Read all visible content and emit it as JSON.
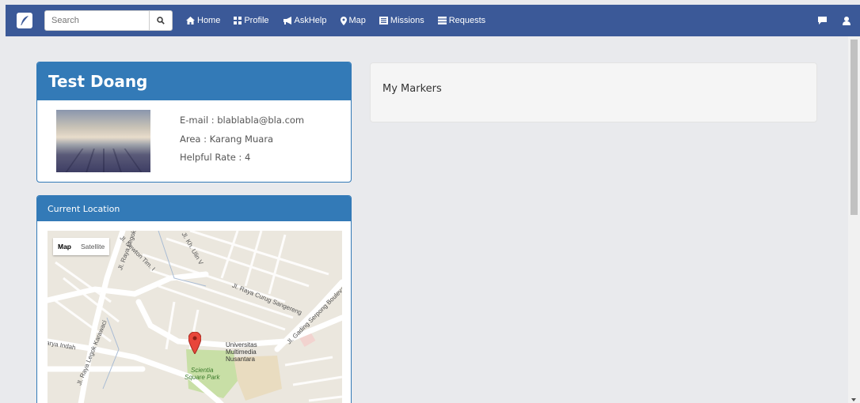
{
  "navbar": {
    "search_placeholder": "Search",
    "items": [
      {
        "label": "Home",
        "icon": "home-icon"
      },
      {
        "label": "Profile",
        "icon": "grid-icon"
      },
      {
        "label": "AskHelp",
        "icon": "bullhorn-icon"
      },
      {
        "label": "Map",
        "icon": "map-marker-icon"
      },
      {
        "label": "Missions",
        "icon": "list-alt-icon"
      },
      {
        "label": "Requests",
        "icon": "list-icon"
      }
    ],
    "right_icons": [
      "comment-icon",
      "user-icon"
    ],
    "bg_color": "#3b5998"
  },
  "profile": {
    "name": "Test Doang",
    "email_line": "E-mail : blablabla@bla.com",
    "area_line": "Area : Karang Muara",
    "rate_line": "Helpful Rate : 4"
  },
  "location": {
    "title": "Current Location",
    "map_type": {
      "map": "Map",
      "satellite": "Satellite"
    },
    "labels": {
      "jl_newton": "Jl. Newton Tim. I",
      "jl_raya_legok": "Jl. Raya Legok",
      "jl_kh": "Jl. Kh. Ulin V",
      "curug": "Jl. Raya Curug Sangereng",
      "gading": "Jl. Gading Serpong Boulevard",
      "legok_karawaci": "Jl. Raya Legok Karawaci",
      "indah": "sarya Indah",
      "umn1": "Universitas",
      "umn2": "Multimedia",
      "umn3": "Nusantara",
      "park1": "Scientia",
      "park2": "Square Park"
    }
  },
  "markers": {
    "title": "My Markers"
  },
  "colors": {
    "primary": "#337ab7",
    "page_bg": "#e9eaed"
  }
}
